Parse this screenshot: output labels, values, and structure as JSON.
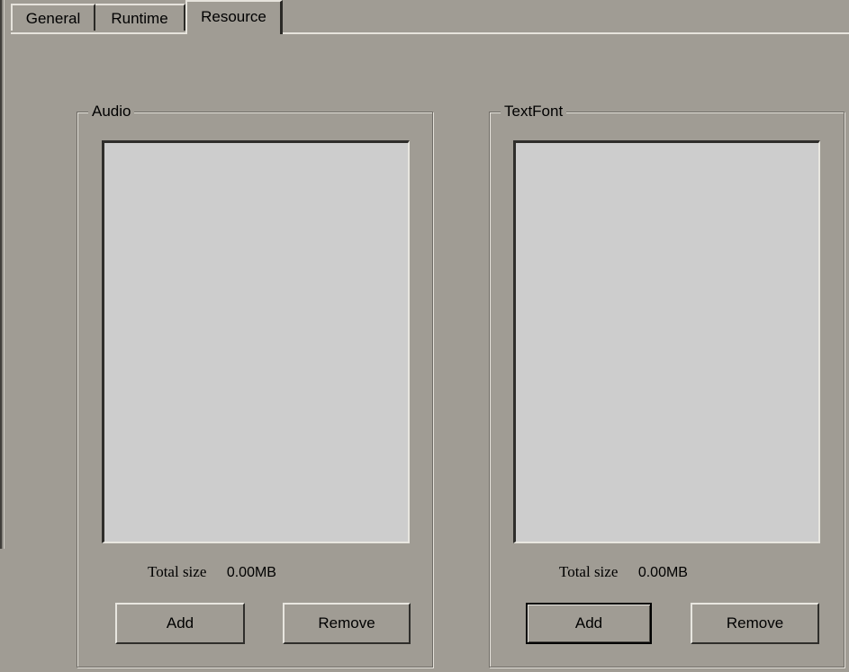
{
  "tabs": [
    {
      "label": "General",
      "active": false
    },
    {
      "label": "Runtime",
      "active": false
    },
    {
      "label": "Resource",
      "active": true
    }
  ],
  "audio": {
    "title": "Audio",
    "total_size_label": "Total size",
    "total_size_value": "0.00MB",
    "add_label": "Add",
    "remove_label": "Remove"
  },
  "textfont": {
    "title": "TextFont",
    "total_size_label": "Total size",
    "total_size_value": "0.00MB",
    "add_label": "Add",
    "remove_label": "Remove"
  },
  "colors": {
    "dialog_bg": "#a09c94",
    "listbox_bg": "#cdcdcd"
  }
}
